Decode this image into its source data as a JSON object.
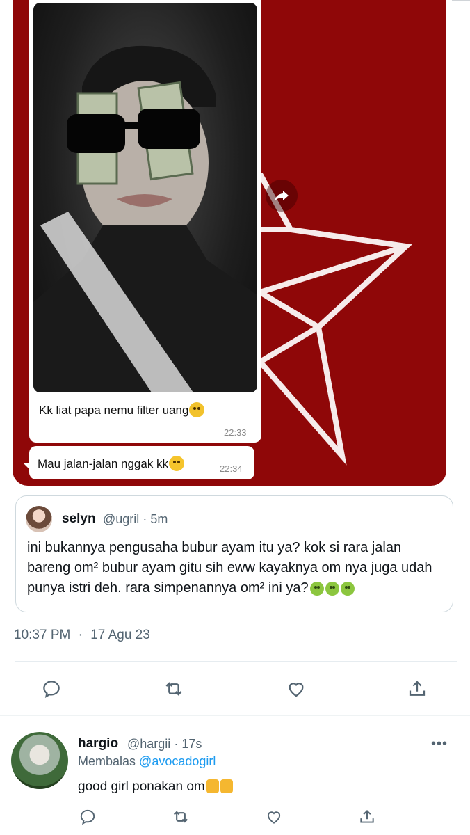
{
  "media": {
    "chat_message_1": "Kk liat papa nemu filter uang",
    "chat_time_1": "22:33",
    "chat_message_2": "Mau jalan-jalan nggak kk",
    "chat_time_2": "22:34",
    "background_color": "#8f0708"
  },
  "quote": {
    "name": "selyn",
    "handle": "@ugril",
    "separator": "·",
    "time": "5m",
    "text": "ini bukannya pengusaha bubur ayam itu ya? kok si rara jalan bareng om² bubur ayam gitu sih eww kayaknya om nya juga udah punya istri deh. rara simpenannya om² ini ya?"
  },
  "tweet_meta": {
    "time": "10:37 PM",
    "separator": "·",
    "date": "17 Agu 23"
  },
  "actions": [
    "reply-icon",
    "retweet-icon",
    "like-icon",
    "share-icon"
  ],
  "reply": {
    "name": "hargio",
    "handle": "@hargii",
    "separator": "·",
    "time": "17s",
    "replying_label": "Membalas",
    "replying_to": "@avocadogirl",
    "text": "good girl ponakan om"
  },
  "colors": {
    "accent": "#1d9bf0",
    "muted": "#536471"
  }
}
